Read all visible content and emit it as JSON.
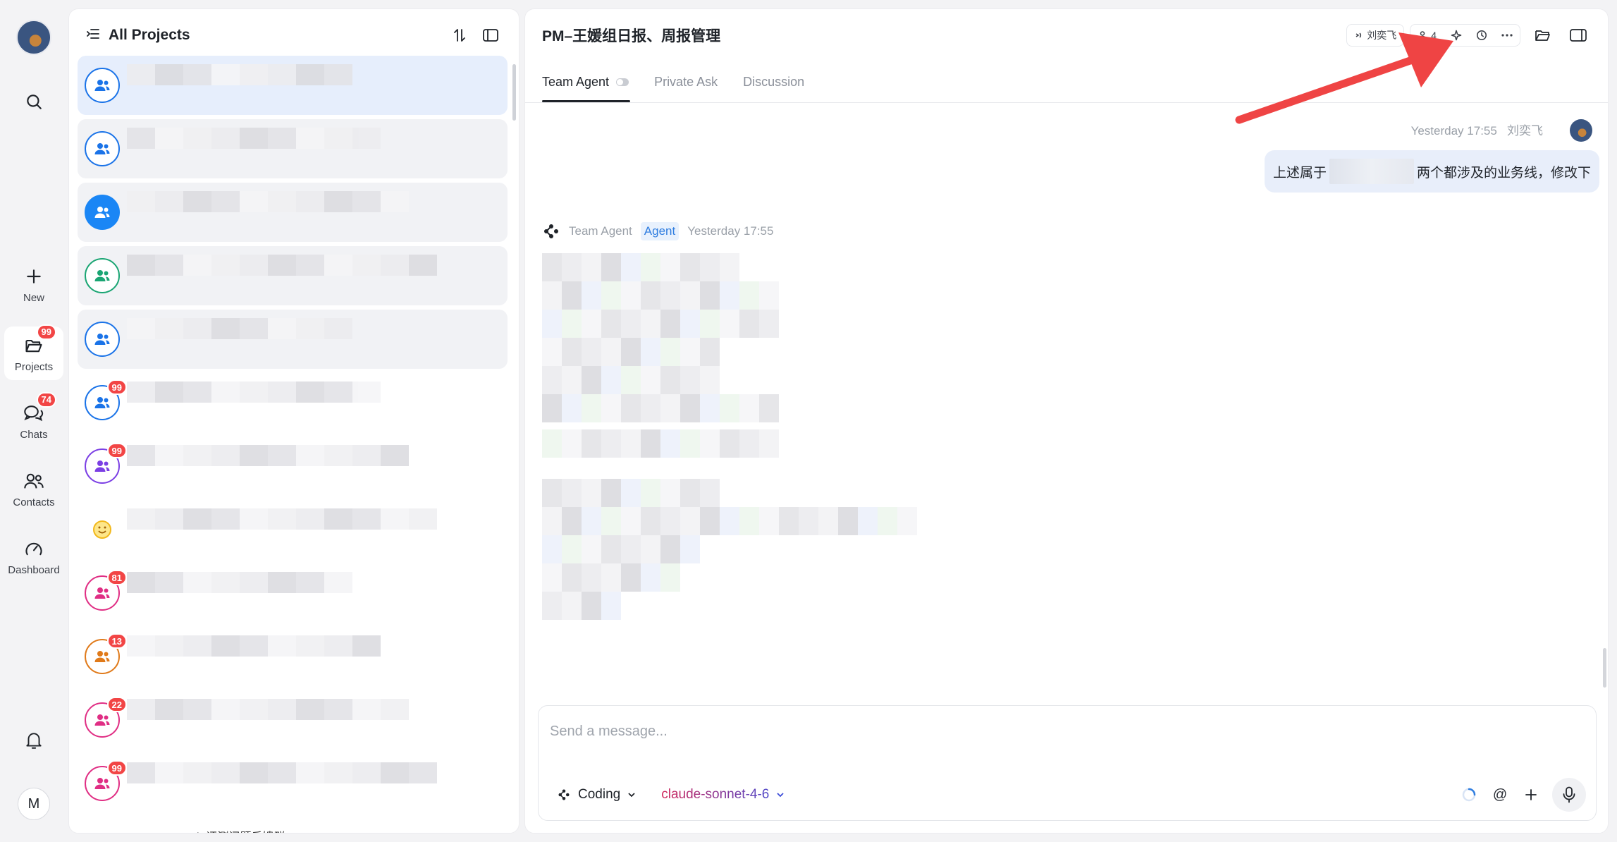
{
  "rail": {
    "items": [
      {
        "id": "new",
        "label": "New"
      },
      {
        "id": "projects",
        "label": "Projects",
        "badge": "99"
      },
      {
        "id": "chats",
        "label": "Chats",
        "badge": "74"
      },
      {
        "id": "contacts",
        "label": "Contacts"
      },
      {
        "id": "dashboard",
        "label": "Dashboard"
      }
    ],
    "me_initial": "M"
  },
  "projects_panel": {
    "title": "All Projects",
    "items": [
      {
        "avatar_color": "#1a73e8",
        "badge": ""
      },
      {
        "avatar_color": "#1a73e8",
        "badge": ""
      },
      {
        "avatar_color": "#1a86f5",
        "badge": "",
        "filled": true
      },
      {
        "avatar_color": "#1aa573",
        "badge": ""
      },
      {
        "avatar_color": "#1a73e8",
        "badge": ""
      },
      {
        "avatar_color": "#1a73e8",
        "badge": "99"
      },
      {
        "avatar_color": "#7b3fe4",
        "badge": "99"
      },
      {
        "avatar_color": "#f2b81b",
        "badge": "",
        "emoji": true
      },
      {
        "avatar_color": "#e02e84",
        "badge": "81"
      },
      {
        "avatar_color": "#e07a1a",
        "badge": "13"
      },
      {
        "avatar_color": "#e02e84",
        "badge": "22"
      },
      {
        "avatar_color": "#e02e84",
        "badge": "99"
      }
    ],
    "tail_text": "GP Web 评测问题反馈群"
  },
  "main": {
    "title": "PM–王媛组日报、周报管理",
    "header": {
      "owner": "刘奕飞",
      "member_count": "4"
    },
    "tabs": [
      {
        "label": "Team Agent",
        "active": true
      },
      {
        "label": "Private Ask",
        "active": false
      },
      {
        "label": "Discussion",
        "active": false
      }
    ],
    "user_message": {
      "time": "Yesterday 17:55",
      "author": "刘奕飞",
      "text_before": "上述属于",
      "text_after": "两个都涉及的业务线，修改下"
    },
    "agent_message": {
      "name": "Team Agent",
      "tag": "Agent",
      "time": "Yesterday 17:55"
    },
    "composer": {
      "placeholder": "Send a message...",
      "mode": "Coding",
      "model": "claude-sonnet-4-6"
    }
  },
  "colors": {
    "accent": "#1a86f5",
    "badge": "#f24545",
    "annotation_arrow": "#ef4444"
  }
}
